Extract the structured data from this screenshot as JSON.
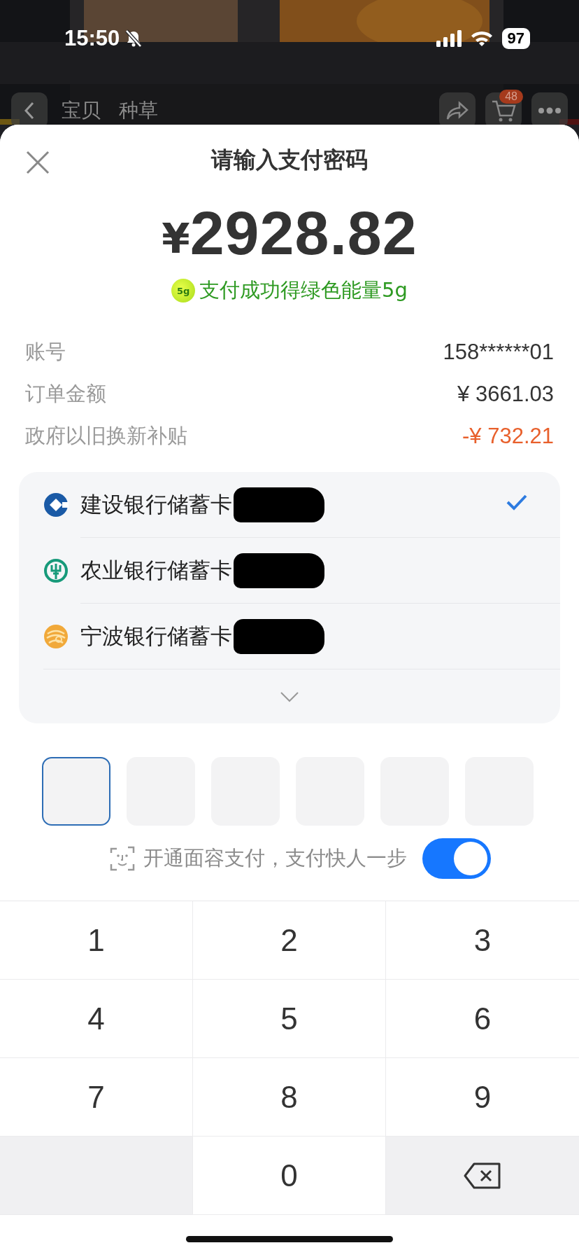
{
  "status_bar": {
    "time": "15:50",
    "silent": true,
    "battery": "97"
  },
  "nav": {
    "tabs": [
      "宝贝",
      "种草"
    ],
    "cart_badge": "48"
  },
  "sheet": {
    "title": "请输入支付密码",
    "currency": "¥",
    "amount": "2928.82",
    "energy_badge": "5g",
    "energy_text": "支付成功得绿色能量5g",
    "details": [
      {
        "label": "账号",
        "value": "158******01",
        "kind": "plain"
      },
      {
        "label": "订单金额",
        "value": "¥ 3661.03",
        "kind": "plain"
      },
      {
        "label": "政府以旧换新补贴",
        "value": "-¥ 732.21",
        "kind": "discount"
      }
    ],
    "cards": [
      {
        "name": "建设银行储蓄卡",
        "kind": "ccb",
        "selected": true,
        "redacted": true
      },
      {
        "name": "农业银行储蓄卡",
        "kind": "abc",
        "selected": false,
        "redacted": true
      },
      {
        "name": "宁波银行储蓄卡",
        "kind": "nbcb",
        "selected": false,
        "redacted": true
      }
    ],
    "pin_boxes": [
      {
        "focused": true
      },
      {
        "focused": false
      },
      {
        "focused": false
      },
      {
        "focused": false
      },
      {
        "focused": false
      },
      {
        "focused": false
      }
    ],
    "face_pay": {
      "text": "开通面容支付，支付快人一步",
      "on": true
    }
  },
  "keypad": [
    {
      "kind": "digit",
      "label": "1"
    },
    {
      "kind": "digit",
      "label": "2"
    },
    {
      "kind": "digit",
      "label": "3"
    },
    {
      "kind": "digit",
      "label": "4"
    },
    {
      "kind": "digit",
      "label": "5"
    },
    {
      "kind": "digit",
      "label": "6"
    },
    {
      "kind": "digit",
      "label": "7"
    },
    {
      "kind": "digit",
      "label": "8"
    },
    {
      "kind": "digit",
      "label": "9"
    },
    {
      "kind": "blank"
    },
    {
      "kind": "digit",
      "label": "0"
    },
    {
      "kind": "delete"
    }
  ]
}
